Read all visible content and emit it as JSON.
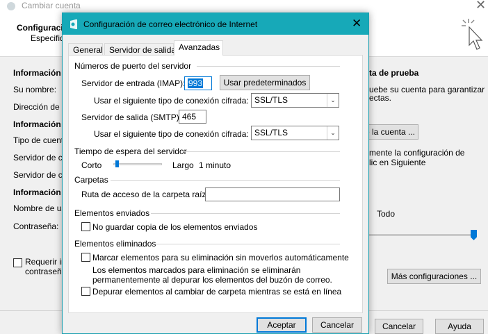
{
  "background": {
    "title": "Cambiar cuenta",
    "header_title": "Configuracio",
    "header_sub": "Especifiq",
    "left": {
      "info_user": "Información s",
      "name_label": "Su nombre:",
      "email_label": "Dirección de c",
      "info_server": "Información c",
      "account_type": "Tipo de cuent",
      "incoming": "Servidor de co",
      "outgoing": "Servidor de co",
      "info_login": "Información c",
      "user_label": "Nombre de us",
      "password_label": "Contraseña:",
      "require_line1": "Requerir in",
      "require_line2": "contraseña"
    },
    "right": {
      "test_title": "ta de prueba",
      "test_desc1": "uebe su cuenta para garantizar",
      "test_desc2": "ectas.",
      "test_button": "e la cuenta ...",
      "auto_desc1": "mente la configuración de",
      "auto_desc2": "lic en Siguiente",
      "slider_label": "Todo",
      "more_settings": "Más configuraciones ..."
    },
    "footer": {
      "cancel": "Cancelar",
      "help": "Ayuda"
    }
  },
  "dialog": {
    "title": "Configuración de correo electrónico de Internet",
    "tabs": [
      "General",
      "Servidor de salida",
      "Avanzadas"
    ],
    "active_tab": "Avanzadas",
    "ports": {
      "section": "Números de puerto del servidor",
      "imap_label": "Servidor de entrada (IMAP):",
      "imap_value": "993",
      "defaults_button": "Usar predeterminados",
      "encryption_label_in": "Usar el siguiente tipo de conexión cifrada:",
      "encryption_in": "SSL/TLS",
      "smtp_label": "Servidor de salida (SMTP):",
      "smtp_value": "465",
      "encryption_label_out": "Usar el siguiente tipo de conexión cifrada:",
      "encryption_out": "SSL/TLS"
    },
    "timeout": {
      "section": "Tiempo de espera del servidor",
      "short": "Corto",
      "long": "Largo",
      "value": "1 minuto"
    },
    "folders": {
      "section": "Carpetas",
      "root_label": "Ruta de acceso de la carpeta raíz:",
      "root_value": ""
    },
    "sent": {
      "section": "Elementos enviados",
      "no_copy": "No guardar copia de los elementos enviados"
    },
    "deleted": {
      "section": "Elementos eliminados",
      "mark": "Marcar elementos para su eliminación sin moverlos automáticamente",
      "note1": "Los elementos marcados para eliminación se eliminarán",
      "note2": "permanentemente al depurar los elementos del buzón de correo.",
      "purge": "Depurar elementos al cambiar de carpeta mientras se está en línea"
    },
    "ok": "Aceptar",
    "cancel": "Cancelar"
  }
}
